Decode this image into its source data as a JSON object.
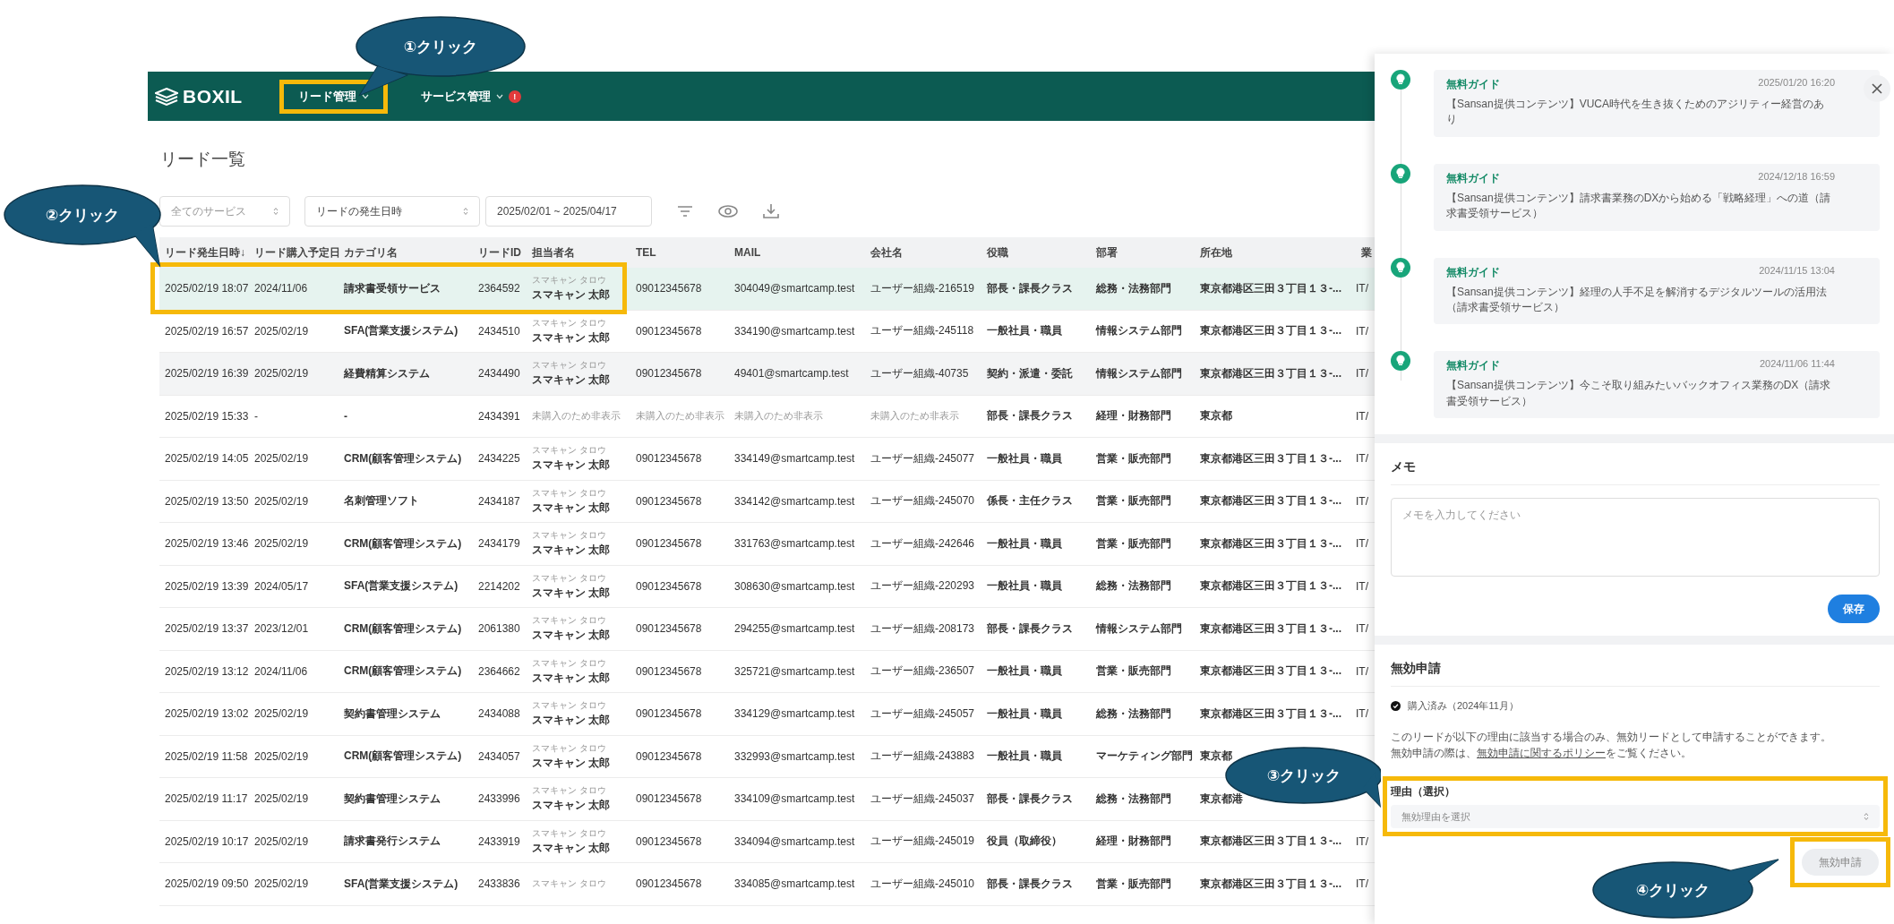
{
  "header": {
    "logo": "BOXIL",
    "nav": [
      {
        "label": "リード管理",
        "annotated": true
      },
      {
        "label": "サービス管理",
        "badge": "!",
        "annotated": false
      }
    ]
  },
  "page_title": "リード一覧",
  "filters": {
    "service_select": {
      "placeholder": "全てのサービス"
    },
    "date_type_select": {
      "value": "リードの発生日時"
    },
    "date_range": {
      "value": "2025/02/01 ~ 2025/04/17"
    }
  },
  "table": {
    "columns": [
      "リード発生日時↓",
      "リード購入予定日",
      "カテゴリ名",
      "リードID",
      "担当者名",
      "TEL",
      "MAIL",
      "会社名",
      "役職",
      "部署",
      "所在地",
      "業"
    ],
    "rows": [
      {
        "occurred": "2025/02/19 18:07",
        "purchase": "2024/11/06",
        "category": "請求書受領サービス",
        "lead_id": "2364592",
        "person_kana": "スマキャン タロウ",
        "person_name": "スマキャン 太郎",
        "tel": "09012345678",
        "mail": "304049@smartcamp.test",
        "company": "ユーザー組織-216519",
        "role": "部長・課長クラス",
        "department": "総務・法務部門",
        "address": "東京都港区三田３丁目１３-...",
        "column_12": "IT/",
        "selected": true,
        "hovered": false,
        "masked": false
      },
      {
        "occurred": "2025/02/19 16:57",
        "purchase": "2025/02/19",
        "category": "SFA(営業支援システム)",
        "lead_id": "2434510",
        "person_kana": "スマキャン タロウ",
        "person_name": "スマキャン 太郎",
        "tel": "09012345678",
        "mail": "334190@smartcamp.test",
        "company": "ユーザー組織-245118",
        "role": "一般社員・職員",
        "department": "情報システム部門",
        "address": "東京都港区三田３丁目１３-...",
        "column_12": "IT/",
        "selected": false,
        "hovered": false,
        "masked": false
      },
      {
        "occurred": "2025/02/19 16:39",
        "purchase": "2025/02/19",
        "category": "経費精算システム",
        "lead_id": "2434490",
        "person_kana": "スマキャン タロウ",
        "person_name": "スマキャン 太郎",
        "tel": "09012345678",
        "mail": "49401@smartcamp.test",
        "company": "ユーザー組織-40735",
        "role": "契約・派遣・委託",
        "department": "情報システム部門",
        "address": "東京都港区三田３丁目１３-...",
        "column_12": "IT/",
        "selected": false,
        "hovered": true,
        "masked": false
      },
      {
        "occurred": "2025/02/19 15:33",
        "purchase": "-",
        "category": "-",
        "lead_id": "2434391",
        "person_name": "未購入のため非表示",
        "tel": "未購入のため非表示",
        "mail": "未購入のため非表示",
        "company": "未購入のため非表示",
        "role": "部長・課長クラス",
        "department": "経理・財務部門",
        "address": "東京都",
        "column_12": "IT/",
        "selected": false,
        "hovered": false,
        "masked": true
      },
      {
        "occurred": "2025/02/19 14:05",
        "purchase": "2025/02/19",
        "category": "CRM(顧客管理システム)",
        "lead_id": "2434225",
        "person_kana": "スマキャン タロウ",
        "person_name": "スマキャン 太郎",
        "tel": "09012345678",
        "mail": "334149@smartcamp.test",
        "company": "ユーザー組織-245077",
        "role": "一般社員・職員",
        "department": "営業・販売部門",
        "address": "東京都港区三田３丁目１３-...",
        "column_12": "IT/",
        "selected": false,
        "hovered": false,
        "masked": false
      },
      {
        "occurred": "2025/02/19 13:50",
        "purchase": "2025/02/19",
        "category": "名刺管理ソフト",
        "lead_id": "2434187",
        "person_kana": "スマキャン タロウ",
        "person_name": "スマキャン 太郎",
        "tel": "09012345678",
        "mail": "334142@smartcamp.test",
        "company": "ユーザー組織-245070",
        "role": "係長・主任クラス",
        "department": "営業・販売部門",
        "address": "東京都港区三田３丁目１３-...",
        "column_12": "IT/",
        "selected": false,
        "hovered": false,
        "masked": false
      },
      {
        "occurred": "2025/02/19 13:46",
        "purchase": "2025/02/19",
        "category": "CRM(顧客管理システム)",
        "lead_id": "2434179",
        "person_kana": "スマキャン タロウ",
        "person_name": "スマキャン 太郎",
        "tel": "09012345678",
        "mail": "331763@smartcamp.test",
        "company": "ユーザー組織-242646",
        "role": "一般社員・職員",
        "department": "営業・販売部門",
        "address": "東京都港区三田３丁目１３-...",
        "column_12": "IT/",
        "selected": false,
        "hovered": false,
        "masked": false
      },
      {
        "occurred": "2025/02/19 13:39",
        "purchase": "2024/05/17",
        "category": "SFA(営業支援システム)",
        "lead_id": "2214202",
        "person_kana": "スマキャン タロウ",
        "person_name": "スマキャン 太郎",
        "tel": "09012345678",
        "mail": "308630@smartcamp.test",
        "company": "ユーザー組織-220293",
        "role": "一般社員・職員",
        "department": "総務・法務部門",
        "address": "東京都港区三田３丁目１３-...",
        "column_12": "IT/",
        "selected": false,
        "hovered": false,
        "masked": false
      },
      {
        "occurred": "2025/02/19 13:37",
        "purchase": "2023/12/01",
        "category": "CRM(顧客管理システム)",
        "lead_id": "2061380",
        "person_kana": "スマキャン タロウ",
        "person_name": "スマキャン 太郎",
        "tel": "09012345678",
        "mail": "294255@smartcamp.test",
        "company": "ユーザー組織-208173",
        "role": "部長・課長クラス",
        "department": "情報システム部門",
        "address": "東京都港区三田３丁目１３-...",
        "column_12": "IT/",
        "selected": false,
        "hovered": false,
        "masked": false
      },
      {
        "occurred": "2025/02/19 13:12",
        "purchase": "2024/11/06",
        "category": "CRM(顧客管理システム)",
        "lead_id": "2364662",
        "person_kana": "スマキャン タロウ",
        "person_name": "スマキャン 太郎",
        "tel": "09012345678",
        "mail": "325721@smartcamp.test",
        "company": "ユーザー組織-236507",
        "role": "一般社員・職員",
        "department": "営業・販売部門",
        "address": "東京都港区三田３丁目１３-...",
        "column_12": "IT/",
        "selected": false,
        "hovered": false,
        "masked": false
      },
      {
        "occurred": "2025/02/19 13:02",
        "purchase": "2025/02/19",
        "category": "契約書管理システム",
        "lead_id": "2434088",
        "person_kana": "スマキャン タロウ",
        "person_name": "スマキャン 太郎",
        "tel": "09012345678",
        "mail": "334129@smartcamp.test",
        "company": "ユーザー組織-245057",
        "role": "一般社員・職員",
        "department": "総務・法務部門",
        "address": "東京都港区三田３丁目１３-...",
        "column_12": "IT/",
        "selected": false,
        "hovered": false,
        "masked": false
      },
      {
        "occurred": "2025/02/19 11:58",
        "purchase": "2025/02/19",
        "category": "CRM(顧客管理システム)",
        "lead_id": "2434057",
        "person_kana": "スマキャン タロウ",
        "person_name": "スマキャン 太郎",
        "tel": "09012345678",
        "mail": "332993@smartcamp.test",
        "company": "ユーザー組織-243883",
        "role": "一般社員・職員",
        "department": "マーケティング部門",
        "address": "東京都",
        "selected": false,
        "hovered": false,
        "masked": false
      },
      {
        "occurred": "2025/02/19 11:17",
        "purchase": "2025/02/19",
        "category": "契約書管理システム",
        "lead_id": "2433996",
        "person_kana": "スマキャン タロウ",
        "person_name": "スマキャン 太郎",
        "tel": "09012345678",
        "mail": "334109@smartcamp.test",
        "company": "ユーザー組織-245037",
        "role": "部長・課長クラス",
        "department": "総務・法務部門",
        "address": "東京都港",
        "selected": false,
        "hovered": false,
        "masked": false
      },
      {
        "occurred": "2025/02/19 10:17",
        "purchase": "2025/02/19",
        "category": "請求書発行システム",
        "lead_id": "2433919",
        "person_kana": "スマキャン タロウ",
        "person_name": "スマキャン 太郎",
        "tel": "09012345678",
        "mail": "334094@smartcamp.test",
        "company": "ユーザー組織-245019",
        "role": "役員（取締役）",
        "department": "経理・財務部門",
        "address": "東京都港区三田３丁目１３-...",
        "column_12": "IT/",
        "selected": false,
        "hovered": false,
        "masked": false
      },
      {
        "occurred": "2025/02/19 09:50",
        "purchase": "2025/02/19",
        "category": "SFA(営業支援システム)",
        "lead_id": "2433836",
        "person_kana": "スマキャン タロウ",
        "tel": "09012345678",
        "mail": "334085@smartcamp.test",
        "company": "ユーザー組織-245010",
        "role": "部長・課長クラス",
        "department": "営業・販売部門",
        "address": "東京都港区三田３丁目１３-...",
        "column_12": "IT/",
        "selected": false,
        "hovered": false,
        "masked": false
      }
    ]
  },
  "side_panel": {
    "timeline": [
      {
        "tag": "無料ガイド",
        "date": "2025/01/20 16:20",
        "title": "【Sansan提供コンテンツ】VUCA時代を生き抜くためのアジリティー経営のあり"
      },
      {
        "tag": "無料ガイド",
        "date": "2024/12/18 16:59",
        "title": "【Sansan提供コンテンツ】請求書業務のDXから始める「戦略経理」への道（請求書受領サービス）"
      },
      {
        "tag": "無料ガイド",
        "date": "2024/11/15 13:04",
        "title": "【Sansan提供コンテンツ】経理の人手不足を解消するデジタルツールの活用法（請求書受領サービス）"
      },
      {
        "tag": "無料ガイド",
        "date": "2024/11/06 11:44",
        "title": "【Sansan提供コンテンツ】今こそ取り組みたいバックオフィス業務のDX（請求書受領サービス）"
      }
    ],
    "memo": {
      "heading": "メモ",
      "placeholder": "メモを入力してください",
      "save_button": "保存"
    },
    "invalid_request": {
      "heading": "無効申請",
      "status": "購入済み（2024年11月）",
      "note_line1": "このリードが以下の理由に該当する場合のみ、無効リードとして申請することができます。",
      "note_before": "無効申請の際は、",
      "note_link": "無効申請に関するポリシー",
      "note_after": "をご覧ください。",
      "reason_label": "理由（選択）",
      "reason_placeholder": "無効理由を選択",
      "reason_annotated": true,
      "submit_button": "無効申請",
      "submit_disabled": true,
      "submit_annotated": true
    }
  },
  "callouts": [
    {
      "label": "①クリック"
    },
    {
      "label": "②クリック"
    },
    {
      "label": "③クリック"
    },
    {
      "label": "④クリック"
    }
  ]
}
